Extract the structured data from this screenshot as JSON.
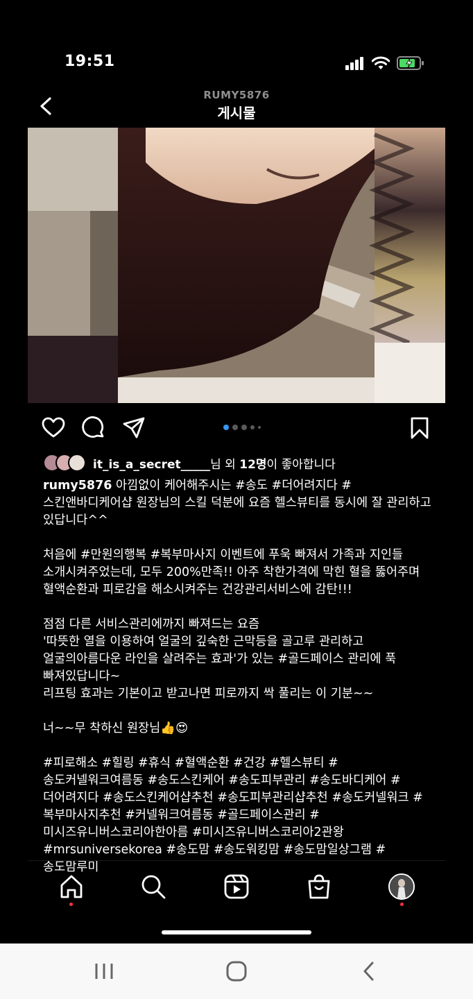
{
  "status": {
    "time": "19:51"
  },
  "header": {
    "username": "RUMY5876",
    "title": "게시물"
  },
  "carousel": {
    "total": 5,
    "active": 0
  },
  "likes": {
    "user": "it_is_a_secret_____",
    "suffix_text": "님 외 ",
    "count": "12명",
    "end_text": "이 좋아합니다"
  },
  "caption": {
    "username": "rumy5876",
    "text": " 아낌없이 케어해주시는 #송도 #더어려지다 #스킨앤바디케어샵 원장님의 스킬 덕분에 요즘 헬스뷰티를 동시에 잘 관리하고 있답니다^^\n\n처음에 #만원의행복 #복부마사지 이벤트에 푸욱 빠져서 가족과 지인들 소개시켜주었는데, 모두 200%만족!! 아주 착한가격에 막힌 혈을 뚫어주며 혈액순환과 피로감을 해소시켜주는 건강관리서비스에 감탄!!!\n\n점점 다른 서비스관리에까지 빠져드는 요즘\n'따뜻한 열을 이용하여 얼굴의 깊숙한 근막등을 골고루 관리하고 얼굴의아름다운 라인을 살려주는 효과'가 있는 #골드페이스 관리에 푹 빠져있답니다~\n리프팅 효과는 기본이고 받고나면 피로까지 싹 풀리는 이 기분~~\n\n너~~무 착하신 원장님👍😍\n\n#피로해소 #힐링 #휴식 #혈액순환 #건강 #헬스뷰티 #송도커넬워크여름동 #송도스킨케어 #송도피부관리 #송도바디케어 #더어려지다 #송도스킨케어샵추천 #송도피부관리샵추천 #송도커넬워크 #복부마사지추천 #커넬워크여름동 #골드페이스관리 #미시즈유니버스코리아한아름 #미시즈유니버스코리아2관왕 #mrsuniversekorea #송도맘 #송도워킹맘 #송도맘일상그램 #송도맘루미"
  },
  "colors": {
    "accent_dot": "#3897f0",
    "notification": "#ff3040",
    "battery": "#4cd964"
  },
  "icons": {
    "actions": [
      "heart-icon",
      "comment-icon",
      "share-icon",
      "bookmark-icon"
    ],
    "tabs": [
      "home-icon",
      "search-icon",
      "reels-icon",
      "shop-icon",
      "profile-avatar"
    ],
    "android_nav": [
      "recents-icon",
      "home-circle-icon",
      "back-icon"
    ]
  }
}
